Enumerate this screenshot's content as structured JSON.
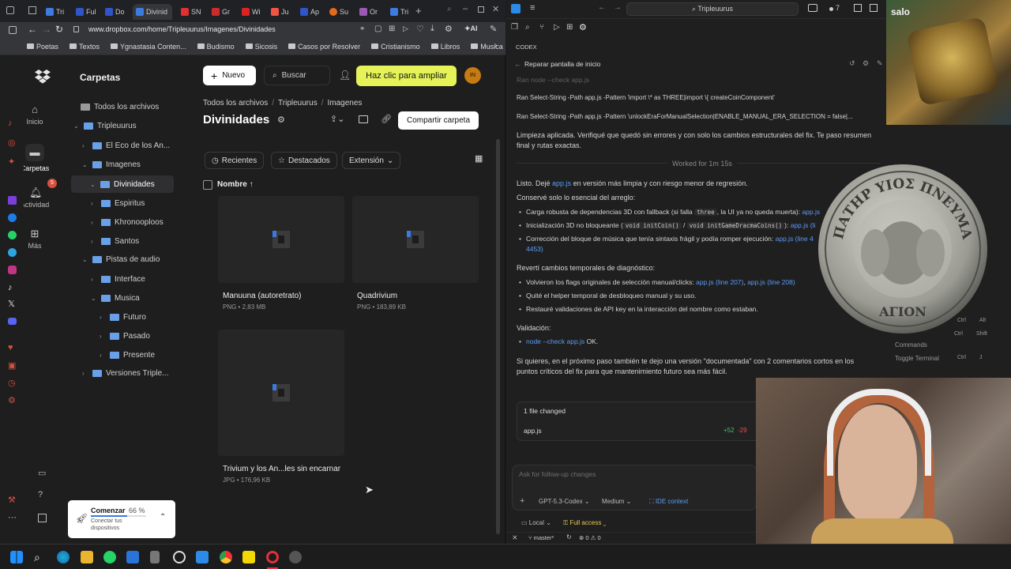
{
  "browser": {
    "tabs": [
      "Tri",
      "Ful",
      "Do",
      "Divinid",
      "SN",
      "Gr",
      "Wi",
      "Ju",
      "Ap",
      "Su",
      "Or",
      "Tri"
    ],
    "url": "www.dropbox.com/home/Tripleuurus/Imagenes/Divinidades",
    "ai_label": "AI",
    "bookmarks": [
      "Poetas",
      "Textos",
      "Ygnastasia Conten...",
      "Budismo",
      "Sicosis",
      "Casos por Resolver",
      "Cristianismo",
      "Libros",
      "Musica"
    ]
  },
  "dropbox": {
    "rail": {
      "home": "Inicio",
      "files": "Carpetas",
      "activity": "Actividad",
      "more": "Más",
      "activity_badge": "5"
    },
    "sidebar_title": "Carpetas",
    "tree": [
      "Todos los archivos",
      "Tripleuurus",
      "El Eco de los An...",
      "Imagenes",
      "Divinidades",
      "Espiritus",
      "Khronooploos",
      "Santos",
      "Pistas de audio",
      "Interface",
      "Musica",
      "Futuro",
      "Pasado",
      "Presente",
      "Versiones Triple..."
    ],
    "new_label": "Nuevo",
    "search_placeholder": "Buscar",
    "upgrade_label": "Haz clic para ampliar",
    "avatar": "IN",
    "breadcrumb": [
      "Todos los archivos",
      "Tripleuurus",
      "Imagenes"
    ],
    "title": "Divinidades",
    "share_label": "Compartir carpeta",
    "filters": [
      "Recientes",
      "Destacados",
      "Extensión"
    ],
    "sort_label": "Nombre",
    "files": [
      {
        "name": "Manuuna (autoretrato)",
        "meta": "PNG • 2,83 MB"
      },
      {
        "name": "Quadrivium",
        "meta": "PNG • 183,89 KB"
      },
      {
        "name": "Trivium y los An...les sin encarnar",
        "meta": "JPG • 176,96 KB"
      }
    ],
    "onboarding": {
      "title": "Comenzar",
      "percent": "66 %",
      "sub1": "Conectar tus",
      "sub2": "dispositivos",
      "progress": 0.66
    }
  },
  "editor": {
    "search": "Tripleuurus",
    "panel_title": "CODEX",
    "task_title": "Reparar pantalla de inicio",
    "ran": [
      "Ran node --check app.js",
      "Ran Select-String -Path app.js -Pattern 'import \\* as THREE|import \\{ createCoinComponent'",
      "Ran Select-String -Path app.js -Pattern 'unlockEraForManualSelection|ENABLE_MANUAL_ERA_SELECTION = false|..."
    ],
    "summary": "Limpieza aplicada. Verifiqué que quedó sin errores y con solo los cambios estructurales del fix. Te paso resumen final y rutas exactas.",
    "worked": "Worked for 1m 15s",
    "listo_pre": "Listo. Dejé",
    "listo_link": "app.js",
    "listo_post": "en versión más limpia y con riesgo menor de regresión.",
    "conserve": "Conservé solo lo esencial del arreglo:",
    "b1": "Carga robusta de dependencias 3D con fallback (si falla",
    "b1_code": "three",
    "b1_post": ", la UI ya no queda muerta):",
    "b1_link": "app.js",
    "b2": "Inicialización 3D no bloqueante (",
    "b2_code1": "void initCoin()",
    "b2_sep": "/",
    "b2_code2": "void initGameDracmaCoins()",
    "b2_post": "):",
    "b2_link": "app.js (li",
    "b3": "Corrección del bloque de música que tenía sintaxis frágil y podía romper ejecución:",
    "b3_link": "app.js (line 4",
    "b3_link2": "4453)",
    "revert": "Revertí cambios temporales de diagnóstico:",
    "r1": "Volvieron los flags originales de selección manual/clicks:",
    "r1_l1": "app.js (line 207)",
    "r1_l2": "app.js (line 208)",
    "r2": "Quité el helper temporal de desbloqueo manual y su uso.",
    "r3": "Restauré validaciones de API key en la interacción del nombre como estaban.",
    "validation": "Validación:",
    "v1_link": "node --check app.js",
    "v1_ok": "OK.",
    "closing": "Si quieres, en el próximo paso también te dejo una versión \"documentada\" con 2 comentarios cortos en los puntos críticos del fix para que mantenimiento futuro sea más fácil.",
    "changed": "1 file changed",
    "changed_file": "app.js",
    "additions": "+52",
    "deletions": "-29",
    "followup_placeholder": "Ask for follow-up changes",
    "model": "GPT-5.3-Codex",
    "effort": "Medium",
    "ide": "IDE context",
    "env": "Local",
    "access": "Full access",
    "branch": "master*",
    "errors": "0",
    "warnings": "0",
    "shortcuts": [
      {
        "k1": "Ctrl",
        "k2": "Alt"
      },
      {
        "k1": "Ctrl",
        "k2": "Shift"
      },
      {
        "k1": "Ctrl",
        "k2": "J"
      }
    ],
    "commands": "Commands",
    "toggle_terminal": "Toggle Terminal",
    "status_badge": "7"
  },
  "overlay": {
    "channel": "salo",
    "coin_text_top": "ΠΑΤΗΡ ΥΙΟΣ ΠΝΕΥΜΑ",
    "coin_text_bottom": "ΑΓΙΟΝ"
  }
}
